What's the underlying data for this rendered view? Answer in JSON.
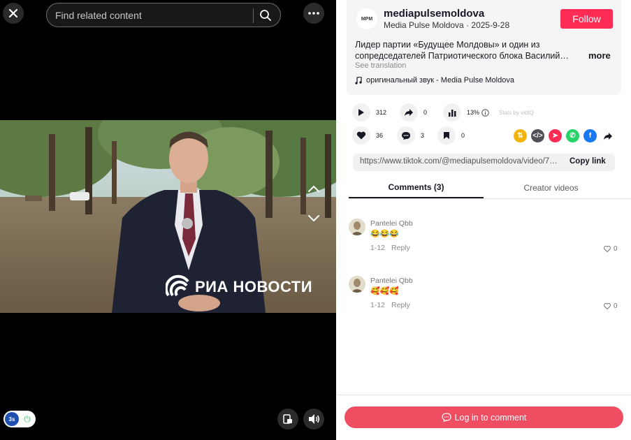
{
  "search": {
    "placeholder": "Find related content"
  },
  "video": {
    "watermark": "РИА НОВОСТИ",
    "ext_badge": "3s"
  },
  "author": {
    "username": "mediapulsemoldova",
    "display_name": "Media Pulse Moldova",
    "date": "2025-9-28",
    "logo_text": "MPM"
  },
  "follow_label": "Follow",
  "description": {
    "line1": "Лидер партии «Будущее Молдовы» и один из",
    "line2": "сопредседателей Патриотического блока Василий…",
    "more": "more",
    "see_translation": "See translation"
  },
  "music": "оригинальный звук - Media Pulse Moldova",
  "stats": {
    "plays": "312",
    "shares": "0",
    "percent": "13%",
    "stats_by": "Stats by vidIQ",
    "likes": "36",
    "comments": "3",
    "saves": "0"
  },
  "share_colors": {
    "repost": "#f5b30a",
    "embed": "#4f4f55",
    "direct": "#fe2c55",
    "whatsapp": "#25d366",
    "facebook": "#1877f2"
  },
  "link": {
    "url": "https://www.tiktok.com/@mediapulsemoldova/video/7…",
    "copy": "Copy link"
  },
  "tabs": {
    "comments": "Comments (3)",
    "creator": "Creator videos"
  },
  "comments": [
    {
      "name": "Pantelei Qbb",
      "text": "😂😂😂",
      "date": "1-12",
      "reply": "Reply",
      "likes": "0"
    },
    {
      "name": "Pantelei Qbb",
      "text": "🥰🥰🥰",
      "date": "1-12",
      "reply": "Reply",
      "likes": "0"
    }
  ],
  "login_label": "Log in to comment"
}
